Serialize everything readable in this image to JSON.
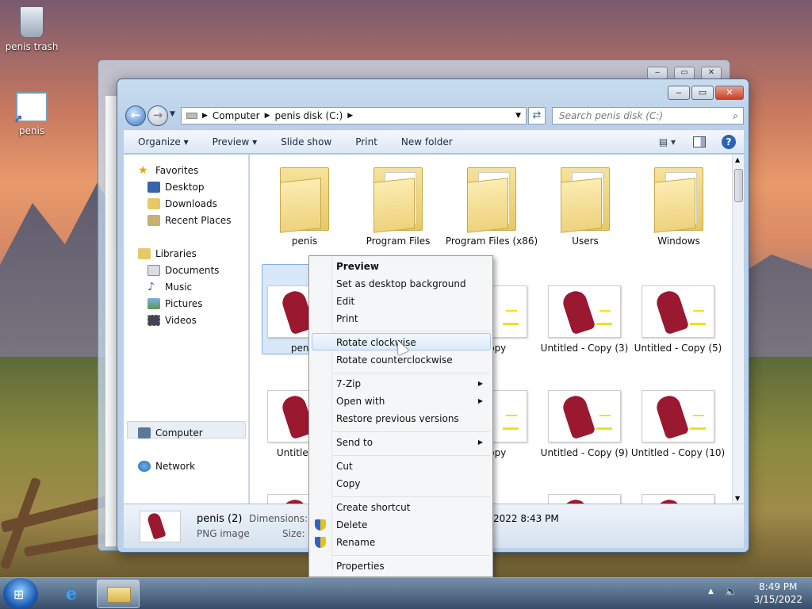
{
  "desktop": {
    "icons": [
      {
        "label": "penis trash"
      },
      {
        "label": "penis"
      }
    ]
  },
  "window": {
    "controls": {
      "minimize": "‒",
      "maximize": "▭",
      "close": "✕"
    },
    "address": {
      "segments": [
        "Computer",
        "penis disk (C:)"
      ]
    },
    "search": {
      "placeholder": "Search penis disk (C:)"
    },
    "toolbar": [
      "Organize ▾",
      "Preview ▾",
      "Slide show",
      "Print",
      "New folder"
    ],
    "nav": {
      "favorites": "Favorites",
      "favorites_items": [
        "Desktop",
        "Downloads",
        "Recent Places"
      ],
      "libraries": "Libraries",
      "libraries_items": [
        "Documents",
        "Music",
        "Pictures",
        "Videos"
      ],
      "computer": "Computer",
      "network": "Network"
    },
    "folders": [
      "penis",
      "Program Files",
      "Program Files (x86)",
      "Users",
      "Windows"
    ],
    "files_row1": [
      {
        "label": "penis"
      },
      {
        "label": "- Copy"
      },
      {
        "label": "Untitled - Copy (3)"
      },
      {
        "label": "Untitled - Copy (5)"
      }
    ],
    "files_row2": [
      {
        "label": "Untitled (6)"
      },
      {
        "label": "- Copy"
      },
      {
        "label": "Untitled - Copy (9)"
      },
      {
        "label": "Untitled - Copy (10)"
      }
    ],
    "details": {
      "name": "penis (2)",
      "type": "PNG image",
      "dimensions_label": "Dimensions: 6",
      "size_label": "Size: 2",
      "date": "2022 8:43 PM"
    }
  },
  "context_menu": {
    "items": [
      {
        "label": "Preview",
        "bold": true
      },
      {
        "label": "Set as desktop background"
      },
      {
        "label": "Edit"
      },
      {
        "label": "Print"
      },
      {
        "label": "Rotate clockwise",
        "highlighted": true
      },
      {
        "label": "Rotate counterclockwise"
      },
      {
        "label": "7-Zip",
        "submenu": true
      },
      {
        "label": "Open with",
        "submenu": true
      },
      {
        "label": "Restore previous versions"
      },
      {
        "label": "Send to",
        "submenu": true
      },
      {
        "label": "Cut"
      },
      {
        "label": "Copy"
      },
      {
        "label": "Create shortcut"
      },
      {
        "label": "Delete",
        "shield": true
      },
      {
        "label": "Rename",
        "shield": true
      },
      {
        "label": "Properties"
      }
    ]
  },
  "taskbar": {
    "time": "8:49 PM",
    "date": "3/15/2022"
  }
}
